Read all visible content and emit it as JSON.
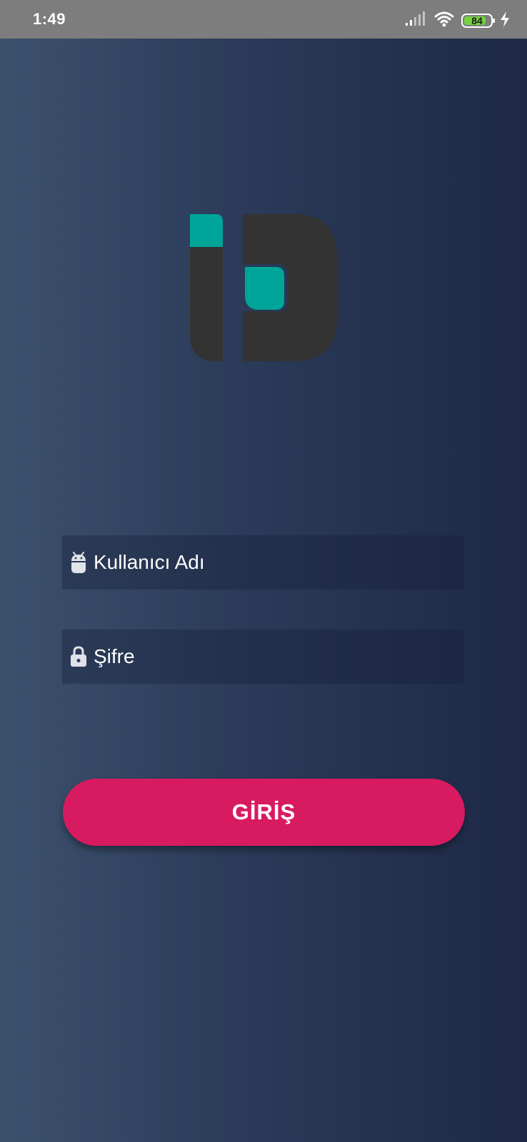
{
  "status_bar": {
    "time": "1:49",
    "battery_level": "84",
    "battery_fraction": 0.84,
    "icons": [
      "signal-icon",
      "wifi-icon",
      "battery-icon",
      "charging-icon"
    ]
  },
  "logo": {
    "name": "app-logo",
    "colors": {
      "teal": "#00a59a",
      "dark": "#333333"
    }
  },
  "form": {
    "username": {
      "icon": "android-icon",
      "placeholder": "Kullanıcı Adı"
    },
    "password": {
      "icon": "lock-icon",
      "placeholder": "Şifre"
    },
    "submit_label": "GİRİŞ"
  },
  "colors": {
    "accent": "#d81b60",
    "background_start": "#3c516d",
    "background_end": "#1d2946",
    "status_bar": "#7d7d7d",
    "battery": "#74d23f"
  }
}
